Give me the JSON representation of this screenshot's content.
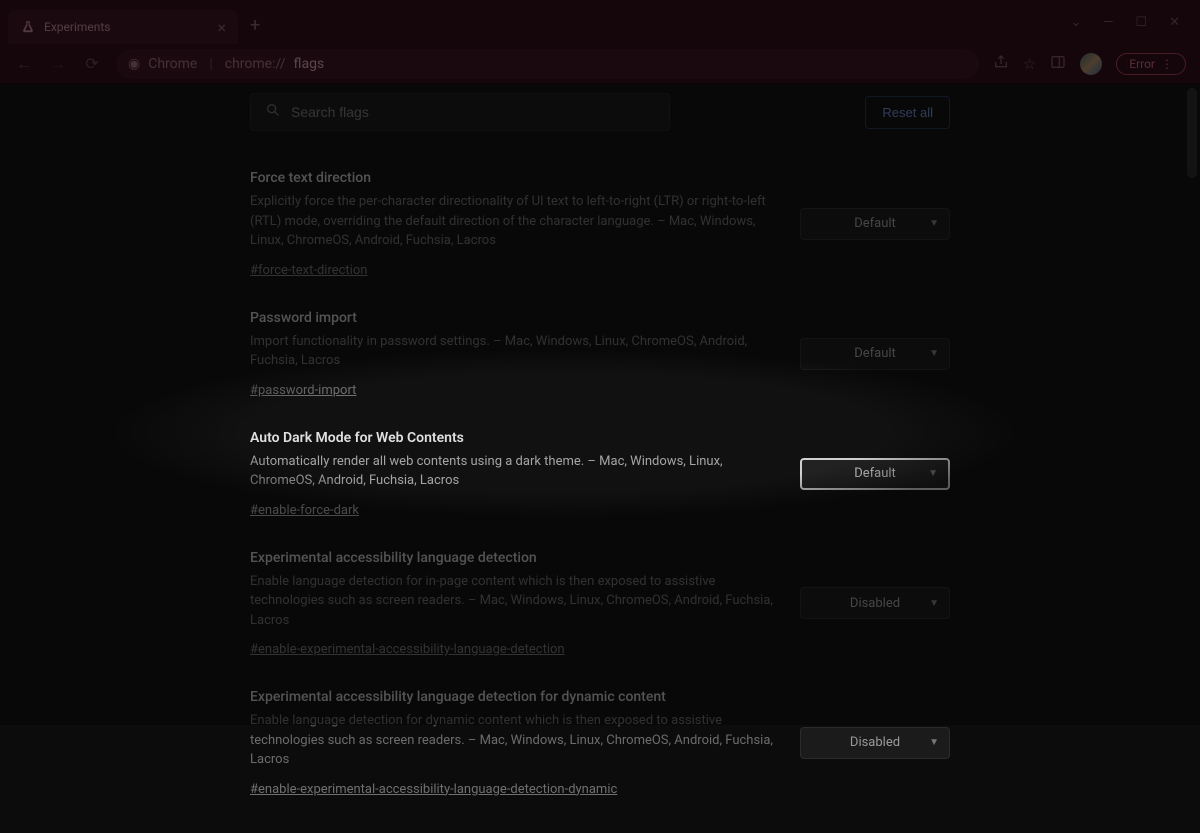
{
  "tab": {
    "title": "Experiments"
  },
  "url": {
    "prefix": "Chrome",
    "scheme": "chrome://",
    "pathBold": "flags"
  },
  "errorBtn": "Error",
  "search": {
    "placeholder": "Search flags"
  },
  "resetLabel": "Reset all",
  "flags": [
    {
      "title": "Force text direction",
      "desc": "Explicitly force the per-character directionality of UI text to left-to-right (LTR) or right-to-left (RTL) mode, overriding the default direction of the character language. – Mac, Windows, Linux, ChromeOS, Android, Fuchsia, Lacros",
      "anchor": "#force-text-direction",
      "value": "Default",
      "highlighted": false
    },
    {
      "title": "Password import",
      "desc": "Import functionality in password settings. – Mac, Windows, Linux, ChromeOS, Android, Fuchsia, Lacros",
      "anchor": "#password-import",
      "value": "Default",
      "highlighted": false
    },
    {
      "title": "Auto Dark Mode for Web Contents",
      "desc": "Automatically render all web contents using a dark theme. – Mac, Windows, Linux, ChromeOS, Android, Fuchsia, Lacros",
      "anchor": "#enable-force-dark",
      "value": "Default",
      "highlighted": true
    },
    {
      "title": "Experimental accessibility language detection",
      "desc": "Enable language detection for in-page content which is then exposed to assistive technologies such as screen readers. – Mac, Windows, Linux, ChromeOS, Android, Fuchsia, Lacros",
      "anchor": "#enable-experimental-accessibility-language-detection",
      "value": "Disabled",
      "highlighted": false
    },
    {
      "title": "Experimental accessibility language detection for dynamic content",
      "desc": "Enable language detection for dynamic content which is then exposed to assistive technologies such as screen readers. – Mac, Windows, Linux, ChromeOS, Android, Fuchsia, Lacros",
      "anchor": "#enable-experimental-accessibility-language-detection-dynamic",
      "value": "Disabled",
      "highlighted": false
    }
  ]
}
